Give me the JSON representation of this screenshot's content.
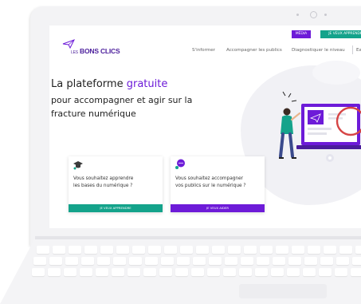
{
  "header": {
    "media_button": "MÉDIA",
    "learn_button": "JE VEUX APPRENDRE",
    "logo_prefix": "LES",
    "logo_name": "BONS CLICS",
    "nav": [
      "S'informer",
      "Accompagner les publics",
      "Diagnostiquer le niveau",
      "Ea"
    ]
  },
  "hero": {
    "title_start": "La plateforme ",
    "title_accent": "gratuite",
    "subtitle_line1": "pour accompagner et agir sur la",
    "subtitle_line2": "fracture numérique"
  },
  "cards": [
    {
      "line1": "Vous souhaitez apprendre",
      "line2": "les bases du numérique ?",
      "button": "JE VEUX APPRENDRE"
    },
    {
      "line1": "Vous souhaitez accompagner",
      "line2": "vos publics sur le numérique ?",
      "button": "JE VEUX AIDER"
    }
  ],
  "colors": {
    "brand_purple": "#6d1bd8",
    "brand_green": "#14a38b",
    "logo_purple": "#4a1d9b",
    "zoom_circle": "#d64545"
  },
  "icons": [
    "send-logo-icon",
    "graduation-cap-icon",
    "chat-bubble-icon",
    "magnifier-illustration"
  ]
}
